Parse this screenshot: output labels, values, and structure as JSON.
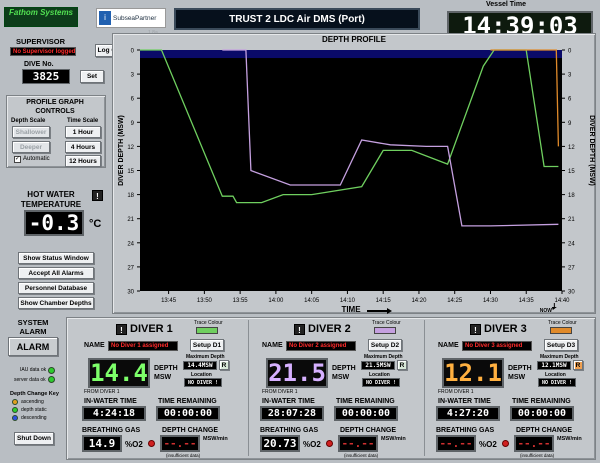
{
  "header": {
    "logo_fathom": "Fathom Systems",
    "logo_subsea": "SubseaPartner",
    "logo_check": "i",
    "faded_text": "1.8a",
    "title": "TRUST 2 LDC Air DMS (Port)",
    "vessel_time_label": "Vessel Time",
    "vessel_time": "14:39:03"
  },
  "supervisor": {
    "label": "SUPERVISOR",
    "value": "No Supervisor logged on",
    "logon_button": "Log On"
  },
  "dive": {
    "label": "DIVE No.",
    "value": "3825",
    "set_button": "Set"
  },
  "profile_controls": {
    "title": "PROFILE GRAPH CONTROLS",
    "depth_scale_label": "Depth Scale",
    "time_scale_label": "Time Scale",
    "shallower": "Shallower",
    "deeper": "Deeper",
    "automatic": "Automatic",
    "t1": "1 Hour",
    "t4": "4 Hours",
    "t12": "12 Hours"
  },
  "hot_water": {
    "label": "HOT WATER TEMPERATURE",
    "value": "-0.3",
    "unit": "°C",
    "warn": "!"
  },
  "side_buttons": [
    "Show Status Window",
    "Accept All Alarms",
    "Personnel Database",
    "Show Chamber Depths"
  ],
  "system_alarm": {
    "label": "SYSTEM ALARM",
    "button": "ALARM"
  },
  "status": {
    "iau": "IAU data ok",
    "server": "server data ok",
    "key_title": "Depth Change Key",
    "ascending": "ascending",
    "static": "depth static",
    "descending": "descending"
  },
  "shutdown": "Shut Down",
  "chart_data": {
    "type": "line",
    "title": "DEPTH PROFILE",
    "xlabel": "TIME",
    "ylabel": "DIVER DEPTH (MSW)",
    "ylabel_right": "DIVER DEPTH (MSW)",
    "now_label": "NOW",
    "x_ticks": [
      "13:45",
      "13:50",
      "13:55",
      "14:00",
      "14:05",
      "14:10",
      "14:15",
      "14:20",
      "14:25",
      "14:30",
      "14:35",
      "14:40"
    ],
    "x_range_minutes": [
      41,
      100
    ],
    "ylim": [
      0,
      30
    ],
    "y_ticks": [
      0,
      3,
      6,
      9,
      12,
      15,
      18,
      21,
      24,
      27,
      30
    ],
    "series": [
      {
        "color": "#6fcf5f",
        "points": [
          [
            41,
            0
          ],
          [
            44,
            0
          ],
          [
            52.5,
            18.2
          ],
          [
            54,
            18.2
          ],
          [
            54.5,
            19
          ],
          [
            58,
            19
          ],
          [
            61,
            18
          ],
          [
            65,
            18
          ],
          [
            72,
            17
          ],
          [
            75,
            12.5
          ],
          [
            79,
            12.5
          ],
          [
            84,
            14.2
          ],
          [
            89,
            2
          ],
          [
            90.5,
            0
          ],
          [
            94,
            0
          ],
          [
            95,
            0
          ],
          [
            97.5,
            14.5
          ],
          [
            99.5,
            14.5
          ]
        ]
      },
      {
        "color": "#c5a0e0",
        "points": [
          [
            52.5,
            0
          ],
          [
            55.8,
            0
          ],
          [
            56.5,
            15
          ],
          [
            62,
            16.8
          ],
          [
            69,
            16.8
          ],
          [
            72,
            11.2
          ],
          [
            76,
            11.8
          ],
          [
            81,
            12
          ],
          [
            84,
            12
          ],
          [
            86,
            21.9
          ],
          [
            90,
            21.9
          ],
          [
            99.5,
            21.7
          ]
        ]
      },
      {
        "color": "#e08a2a",
        "points": [
          [
            90,
            0
          ],
          [
            99.2,
            0
          ],
          [
            99.5,
            12
          ]
        ]
      }
    ]
  },
  "divers": [
    {
      "title": "DIVER 1",
      "warn": "!",
      "trace_label": "Trace Colour",
      "trace_color": "#6fcf5f",
      "name_label": "NAME",
      "name": "No Diver 1 assigned",
      "setup": "Setup D1",
      "depth": "14.4",
      "depth_color": "#7dff6a",
      "depth_label": "DEPTH MSW",
      "max_label": "Maximum Depth",
      "max_value": "14.4MSW",
      "r_button": "R",
      "r_color": "#d8e8d8",
      "location_label": "Location",
      "location": "NO DIVER !",
      "from_label": "FROM DIVER 1",
      "inwater_label": "IN-WATER TIME",
      "inwater": "4:24:18",
      "remaining_label": "TIME REMAINING",
      "remaining": "00:00:00",
      "gas_label": "BREATHING GAS",
      "gas": "14.9",
      "gas_unit": "%O2",
      "change_label": "DEPTH CHANGE",
      "change": "--.--",
      "change_unit": "MSW/min",
      "insufficient": "(insufficient data)"
    },
    {
      "title": "DIVER 2",
      "warn": "!",
      "trace_label": "Trace Colour",
      "trace_color": "#c5a0e0",
      "name_label": "NAME",
      "name": "No Diver 2 assigned",
      "setup": "Setup D2",
      "depth": "21.5",
      "depth_color": "#d6b0ff",
      "depth_label": "DEPTH MSW",
      "max_label": "Maximum Depth",
      "max_value": "21.5MSW",
      "r_button": "R",
      "r_color": "#d8e8d8",
      "location_label": "Location",
      "location": "NO DIVER !",
      "from_label": "FROM DIVER 1",
      "inwater_label": "IN-WATER TIME",
      "inwater": "28:07:28",
      "remaining_label": "TIME REMAINING",
      "remaining": "00:00:00",
      "gas_label": "BREATHING GAS",
      "gas": "20.73",
      "gas_unit": "%O2",
      "change_label": "DEPTH CHANGE",
      "change": "--.--",
      "change_unit": "MSW/min",
      "insufficient": "(insufficient data)"
    },
    {
      "title": "DIVER 3",
      "warn": "!",
      "trace_label": "Trace Colour",
      "trace_color": "#e08a2a",
      "name_label": "NAME",
      "name": "No Diver 3 assigned",
      "setup": "Setup D3",
      "depth": "12.1",
      "depth_color": "#ffb040",
      "depth_label": "DEPTH MSW",
      "max_label": "Maximum Depth",
      "max_value": "12.1MSW",
      "r_button": "R",
      "r_color": "#f0a050",
      "location_label": "Location",
      "location": "NO DIVER !",
      "from_label": "FROM DIVER 1",
      "inwater_label": "IN-WATER TIME",
      "inwater": "4:27:20",
      "remaining_label": "TIME REMAINING",
      "remaining": "00:00:00",
      "gas_label": "BREATHING GAS",
      "gas": "--.--",
      "gas_unit": "%O2",
      "change_label": "DEPTH CHANGE",
      "change": "--.--",
      "change_unit": "MSW/min",
      "insufficient": "(insufficient data)"
    }
  ]
}
